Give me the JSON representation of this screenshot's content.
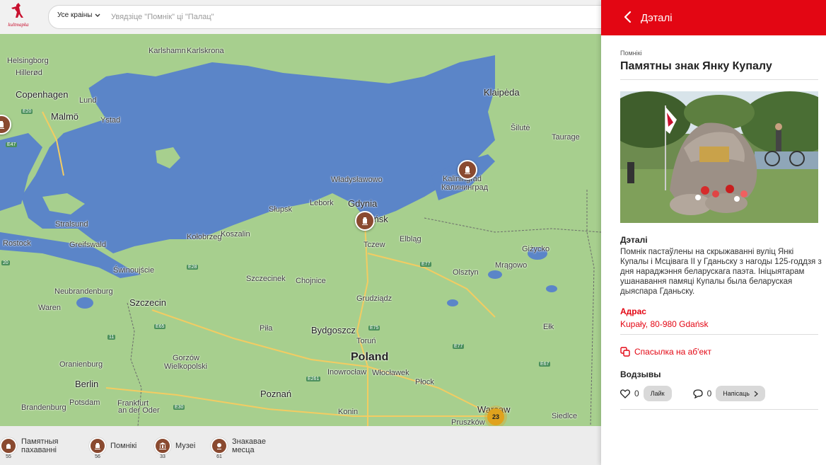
{
  "app": {
    "logo_text": "kultmapka"
  },
  "search": {
    "country_label": "Усе краіны",
    "placeholder": "Увядзіце \"Помнік\" ці \"Палац\"",
    "value": ""
  },
  "map": {
    "cities": [
      {
        "name": "Helsingborg",
        "cls": ""
      },
      {
        "name": "Hillerød",
        "cls": ""
      },
      {
        "name": "Copenhagen",
        "cls": "big"
      },
      {
        "name": "Lund",
        "cls": ""
      },
      {
        "name": "Malmö",
        "cls": "big"
      },
      {
        "name": "Ystad",
        "cls": ""
      },
      {
        "name": "Karlshamn",
        "cls": ""
      },
      {
        "name": "Karlskrona",
        "cls": ""
      },
      {
        "name": "Klaipėda",
        "cls": "big"
      },
      {
        "name": "Šilutė",
        "cls": ""
      },
      {
        "name": "Taurage",
        "cls": ""
      },
      {
        "name": "Władysławowo",
        "cls": ""
      },
      {
        "name": "Kaliningrad",
        "cls": ""
      },
      {
        "name": "Калининград",
        "cls": ""
      },
      {
        "name": "Gdynia",
        "cls": "big"
      },
      {
        "name": "Gdańsk",
        "cls": "big"
      },
      {
        "name": "Lebork",
        "cls": ""
      },
      {
        "name": "Słupsk",
        "cls": ""
      },
      {
        "name": "Kołobrzeg",
        "cls": ""
      },
      {
        "name": "Koszalin",
        "cls": ""
      },
      {
        "name": "Stralsund",
        "cls": ""
      },
      {
        "name": "Rostock",
        "cls": ""
      },
      {
        "name": "Greifswald",
        "cls": ""
      },
      {
        "name": "Świnoujście",
        "cls": ""
      },
      {
        "name": "Neubrandenburg",
        "cls": ""
      },
      {
        "name": "Szczecin",
        "cls": "big"
      },
      {
        "name": "Waren",
        "cls": ""
      },
      {
        "name": "Tczew",
        "cls": ""
      },
      {
        "name": "Elbląg",
        "cls": ""
      },
      {
        "name": "Giżycko",
        "cls": ""
      },
      {
        "name": "Szczecinek",
        "cls": ""
      },
      {
        "name": "Chojnice",
        "cls": ""
      },
      {
        "name": "Olsztyn",
        "cls": ""
      },
      {
        "name": "Mrągowo",
        "cls": ""
      },
      {
        "name": "Grudziądz",
        "cls": ""
      },
      {
        "name": "Piła",
        "cls": ""
      },
      {
        "name": "Bydgoszcz",
        "cls": "big"
      },
      {
        "name": "Toruń",
        "cls": ""
      },
      {
        "name": "Poland",
        "cls": "huge"
      },
      {
        "name": "Ełk",
        "cls": ""
      },
      {
        "name": "Gorzów",
        "cls": ""
      },
      {
        "name": "Wielkopolski",
        "cls": ""
      },
      {
        "name": "Oranienburg",
        "cls": ""
      },
      {
        "name": "Inowrocław",
        "cls": ""
      },
      {
        "name": "Włocławek",
        "cls": ""
      },
      {
        "name": "Berlin",
        "cls": "big"
      },
      {
        "name": "Potsdam",
        "cls": ""
      },
      {
        "name": "Płock",
        "cls": ""
      },
      {
        "name": "Poznań",
        "cls": "big"
      },
      {
        "name": "Brandenburg",
        "cls": ""
      },
      {
        "name": "Frankfurt",
        "cls": ""
      },
      {
        "name": "an der Oder",
        "cls": ""
      },
      {
        "name": "Konin",
        "cls": ""
      },
      {
        "name": "Warsaw",
        "cls": "big"
      },
      {
        "name": "Siedlce",
        "cls": ""
      },
      {
        "name": "Pruszków",
        "cls": ""
      }
    ],
    "roads": [
      "E20",
      "E47",
      "E28",
      "E65",
      "E77",
      "E75",
      "E261",
      "E30",
      "E67",
      "E77",
      "20",
      "11"
    ],
    "cluster_count": "23"
  },
  "legend": [
    {
      "label": "Памятныя пахаванні",
      "count": "55"
    },
    {
      "label": "Помнікі",
      "count": "56"
    },
    {
      "label": "Музеі",
      "count": "33"
    },
    {
      "label": "Знакавае месца",
      "count": "61"
    }
  ],
  "panel": {
    "header": "Дэталі",
    "category": "Помнікі",
    "title": "Памятны знак Янку Купалу",
    "details_title": "Дэталі",
    "description": "Помнік пастаўлены на скрыжаванні вуліц Янкі Купалы і Мсцівага II у Гданьску з нагоды 125-годдзя з дня нараджэння беларускага паэта. Ініцыятарам ушанавання памяці Купалы была беларуская дыяспара Гданьску.",
    "address_title": "Адрас",
    "address": "Kupały, 80-980 Gdańsk",
    "link_label": "Спасылка на аб'ект",
    "reviews_title": "Водзывы",
    "likes": "0",
    "like_label": "Лайк",
    "comments": "0",
    "write_label": "Напісаць"
  },
  "colors": {
    "accent": "#e30613",
    "pin": "#8a4a30",
    "water": "#5b85c8",
    "land": "#a7cf8e"
  }
}
